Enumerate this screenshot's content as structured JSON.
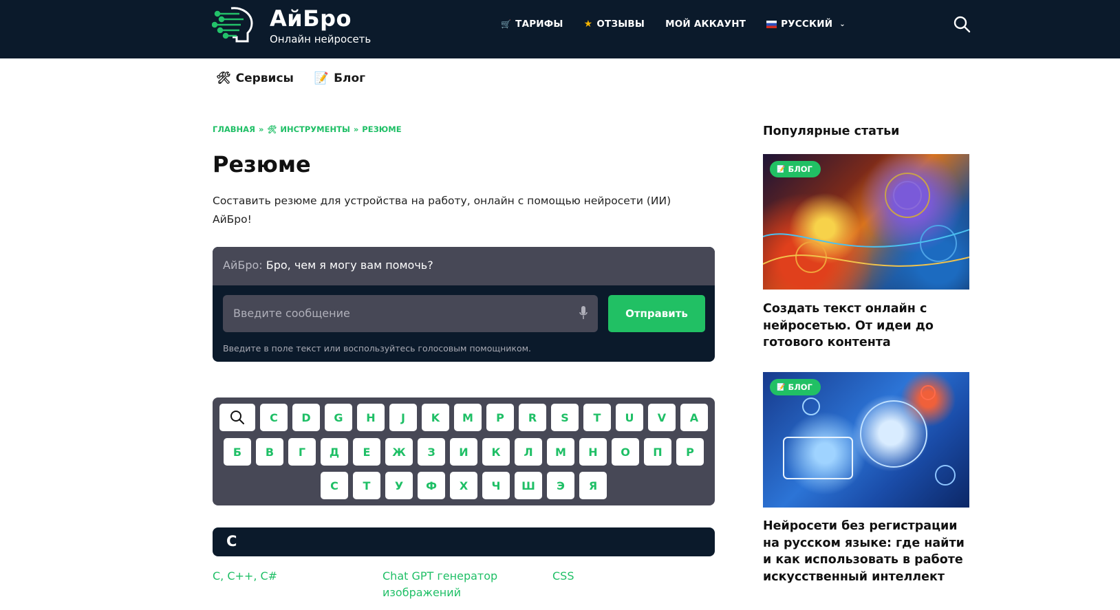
{
  "brand": {
    "title": "АйБро",
    "subtitle": "Онлайн нейросеть"
  },
  "topnav": {
    "tariffs": "ТАРИФЫ",
    "reviews": "ОТЗЫВЫ",
    "account": "МОЙ АККАУНТ",
    "language": "РУССКИЙ"
  },
  "subnav": {
    "services": "Сервисы",
    "blog": "Блог"
  },
  "breadcrumb": {
    "home": "ГЛАВНАЯ",
    "sep": "»",
    "tools": "ИНСТРУМЕНТЫ",
    "current": "РЕЗЮМЕ"
  },
  "page": {
    "title": "Резюме",
    "intro": "Составить резюме для устройства на работу, онлайн с помощью нейросети (ИИ) АйБро!"
  },
  "chat": {
    "bot_name": "АйБро:",
    "greeting": "Бро, чем я могу вам помочь?",
    "placeholder": "Введите сообщение",
    "send": "Отправить",
    "hint": "Введите в поле текст или воспользуйтесь голосовым помощником."
  },
  "keyboard": {
    "row1": [
      "C",
      "D",
      "G",
      "H",
      "J",
      "K",
      "M",
      "P",
      "R",
      "S",
      "T",
      "U",
      "V",
      "А"
    ],
    "row2": [
      "Б",
      "В",
      "Г",
      "Д",
      "Е",
      "Ж",
      "З",
      "И",
      "К",
      "Л",
      "М",
      "Н",
      "О",
      "П",
      "Р"
    ],
    "row3": [
      "С",
      "Т",
      "У",
      "Ф",
      "Х",
      "Ч",
      "Ш",
      "Э",
      "Я"
    ]
  },
  "section": {
    "letter": "C",
    "links": [
      "C, C++, C#",
      "Chat GPT генератор изображений",
      "CSS"
    ]
  },
  "sidebar": {
    "title": "Популярные статьи",
    "badge": "БЛОГ",
    "articles": [
      "Создать текст онлайн с нейросетью. От идеи до готового контента",
      "Нейросети без регистрации на русском языке: где найти и как использовать в работе искусственный интеллект"
    ]
  },
  "colors": {
    "header_bg": "#0b1a2b",
    "accent": "#21c064",
    "panel": "#474856"
  }
}
